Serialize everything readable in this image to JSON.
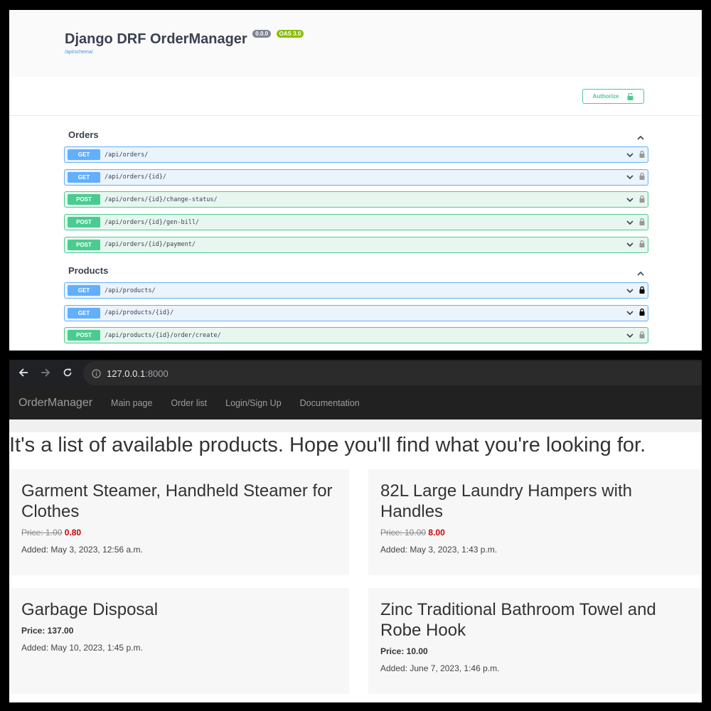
{
  "swagger": {
    "title": "Django DRF OrderManager",
    "version_badge": "0.0.0",
    "oas_badge": "OAS 3.0",
    "schema_link": "/api/schema/",
    "authorize_label": "Authorize",
    "colors": {
      "get": "#61affe",
      "post": "#49cc90",
      "version_badge": "#7d8492",
      "oas_badge": "#89bf04"
    },
    "sections": [
      {
        "title": "Orders",
        "operations": [
          {
            "method": "GET",
            "path": "/api/orders/",
            "locked": false
          },
          {
            "method": "GET",
            "path": "/api/orders/{id}/",
            "locked": false
          },
          {
            "method": "POST",
            "path": "/api/orders/{id}/change-status/",
            "locked": false
          },
          {
            "method": "POST",
            "path": "/api/orders/{id}/gen-bill/",
            "locked": false
          },
          {
            "method": "POST",
            "path": "/api/orders/{id}/payment/",
            "locked": false
          }
        ]
      },
      {
        "title": "Products",
        "operations": [
          {
            "method": "GET",
            "path": "/api/products/",
            "locked": true
          },
          {
            "method": "GET",
            "path": "/api/products/{id}/",
            "locked": true
          },
          {
            "method": "POST",
            "path": "/api/products/{id}/order/create/",
            "locked": false
          }
        ]
      }
    ]
  },
  "browser": {
    "url_host": "127.0.0.1",
    "url_port": ":8000"
  },
  "site": {
    "brand": "OrderManager",
    "nav": [
      "Main page",
      "Order list",
      "Login/Sign Up",
      "Documentation"
    ],
    "headline": "It's a list of available products. Hope you'll find what you're looking for.",
    "products": [
      {
        "title": "Garment Steamer, Handheld Steamer for Clothes",
        "old_price": "Price: 1.00",
        "new_price": "0.80",
        "added": "Added: May 3, 2023, 12:56 a.m."
      },
      {
        "title": "82L Large Laundry Hampers with Handles",
        "old_price": "Price: 10.00",
        "new_price": "8.00",
        "added": "Added: May 3, 2023, 1:43 p.m."
      },
      {
        "title": "Garbage Disposal",
        "price": "Price: 137.00",
        "added": "Added: May 10, 2023, 1:45 p.m."
      },
      {
        "title": "Zinc Traditional Bathroom Towel and Robe Hook",
        "price": "Price: 10.00",
        "added": "Added: June 7, 2023, 1:46 p.m."
      }
    ]
  }
}
